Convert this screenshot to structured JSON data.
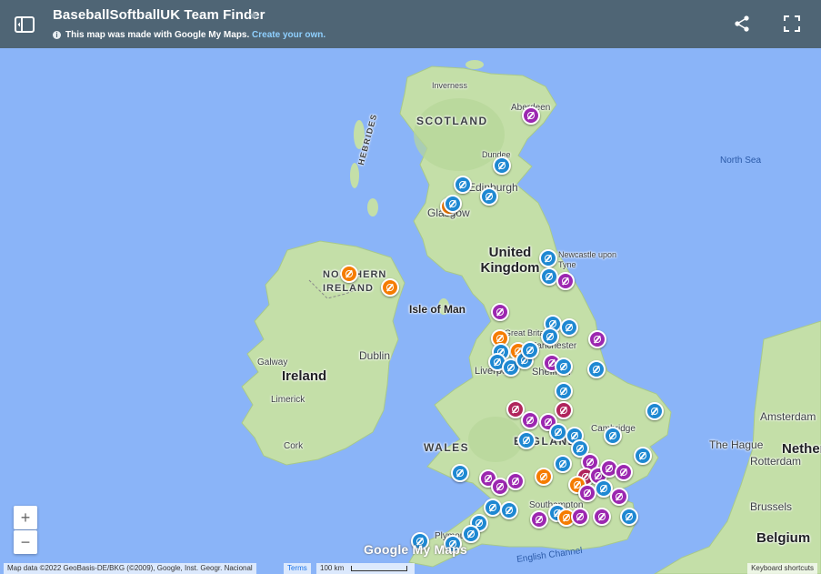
{
  "header": {
    "title": "BaseballSoftballUK Team Finder",
    "star": "★",
    "info": "i",
    "subtitle": "This map was made with Google My Maps.",
    "create_link": "Create your own."
  },
  "colors": {
    "blue": "#1e88d2",
    "orange": "#f57c00",
    "purple": "#9c27b0",
    "magenta": "#b0245c"
  },
  "labels": {
    "scotland": "SCOTLAND",
    "hebrides": "HEBRIDES",
    "inverness": "Inverness",
    "aberdeen": "Aberdeen",
    "dundee": "Dundee",
    "edinburgh": "Edinburgh",
    "glasgow": "Glasgow",
    "united_kingdom": "United Kingdom",
    "newcastle": "Newcastle upon Tyne",
    "northern_ireland": "NORTHERN IRELAND",
    "isle_of_man": "Isle of Man",
    "great_britain": "Great Britain",
    "manchester": "Manchester",
    "liverpool": "Liverpool",
    "sheffield": "Sheffield",
    "dublin": "Dublin",
    "ireland": "Ireland",
    "galway": "Galway",
    "limerick": "Limerick",
    "cork": "Cork",
    "wales": "WALES",
    "england": "ENGLAND",
    "cambridge": "Cambridge",
    "southampton": "Southampton",
    "plymouth": "Plymouth",
    "north_sea": "North Sea",
    "english_channel": "English Channel",
    "amsterdam": "Amsterdam",
    "the_hague": "The Hague",
    "netherlands": "Netherlands",
    "rotterdam": "Rotterdam",
    "brussels": "Brussels",
    "belgium": "Belgium"
  },
  "map_controls": {
    "zoom_in": "+",
    "zoom_out": "−"
  },
  "logo": "Google My Maps",
  "footer": {
    "attribution": "Map data ©2022 GeoBasis-DE/BKG (©2009), Google, Inst. Geogr. Nacional",
    "terms": "Terms",
    "scale": "100 km",
    "keyboard": "Keyboard shortcuts"
  }
}
